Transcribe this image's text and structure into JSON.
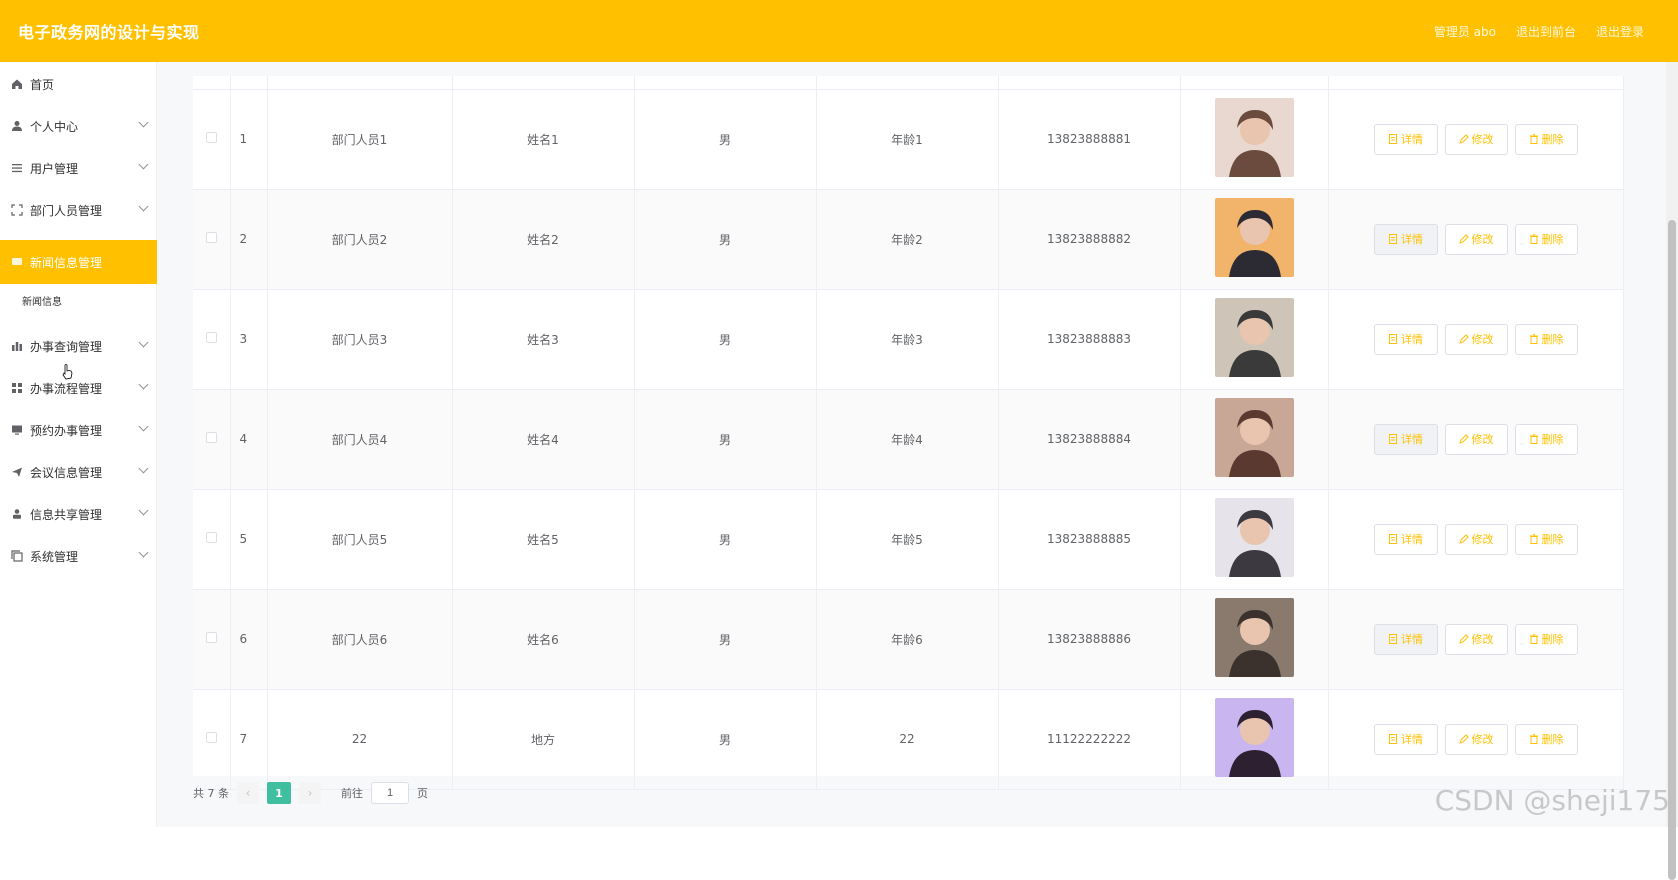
{
  "header": {
    "title": "电子政务网的设计与实现",
    "admin_label": "管理员 abo",
    "to_front": "退出到前台",
    "logout": "退出登录"
  },
  "sidebar": {
    "items": [
      {
        "label": "首页",
        "icon": "home-icon"
      },
      {
        "label": "个人中心",
        "icon": "user-icon"
      },
      {
        "label": "用户管理",
        "icon": "list-icon"
      },
      {
        "label": "部门人员管理",
        "icon": "fullscreen-icon"
      },
      {
        "label": "新闻信息管理",
        "icon": "message-icon"
      },
      {
        "label": "办事查询管理",
        "icon": "chart-icon"
      },
      {
        "label": "办事流程管理",
        "icon": "grid-icon"
      },
      {
        "label": "预约办事管理",
        "icon": "monitor-icon"
      },
      {
        "label": "会议信息管理",
        "icon": "send-icon"
      },
      {
        "label": "信息共享管理",
        "icon": "person-icon"
      },
      {
        "label": "系统管理",
        "icon": "copy-icon"
      }
    ],
    "sub_news": "新闻信息"
  },
  "table": {
    "rows": [
      {
        "idx": "1",
        "account": "部门人员1",
        "name": "姓名1",
        "gender": "男",
        "age": "年龄1",
        "phone": "13823888881"
      },
      {
        "idx": "2",
        "account": "部门人员2",
        "name": "姓名2",
        "gender": "男",
        "age": "年龄2",
        "phone": "13823888882"
      },
      {
        "idx": "3",
        "account": "部门人员3",
        "name": "姓名3",
        "gender": "男",
        "age": "年龄3",
        "phone": "13823888883"
      },
      {
        "idx": "4",
        "account": "部门人员4",
        "name": "姓名4",
        "gender": "男",
        "age": "年龄4",
        "phone": "13823888884"
      },
      {
        "idx": "5",
        "account": "部门人员5",
        "name": "姓名5",
        "gender": "男",
        "age": "年龄5",
        "phone": "13823888885"
      },
      {
        "idx": "6",
        "account": "部门人员6",
        "name": "姓名6",
        "gender": "男",
        "age": "年龄6",
        "phone": "13823888886"
      },
      {
        "idx": "7",
        "account": "22",
        "name": "地方",
        "gender": "男",
        "age": "22",
        "phone": "11122222222"
      }
    ],
    "btn_detail": "详情",
    "btn_edit": "修改",
    "btn_delete": "删除"
  },
  "pager": {
    "total": "共 7 条",
    "current": "1",
    "goto_prefix": "前往",
    "goto_value": "1",
    "goto_suffix": "页"
  },
  "watermark": "CSDN @sheji175",
  "colors": {
    "accent": "#ffc000",
    "pager_active": "#3fbf9f"
  }
}
